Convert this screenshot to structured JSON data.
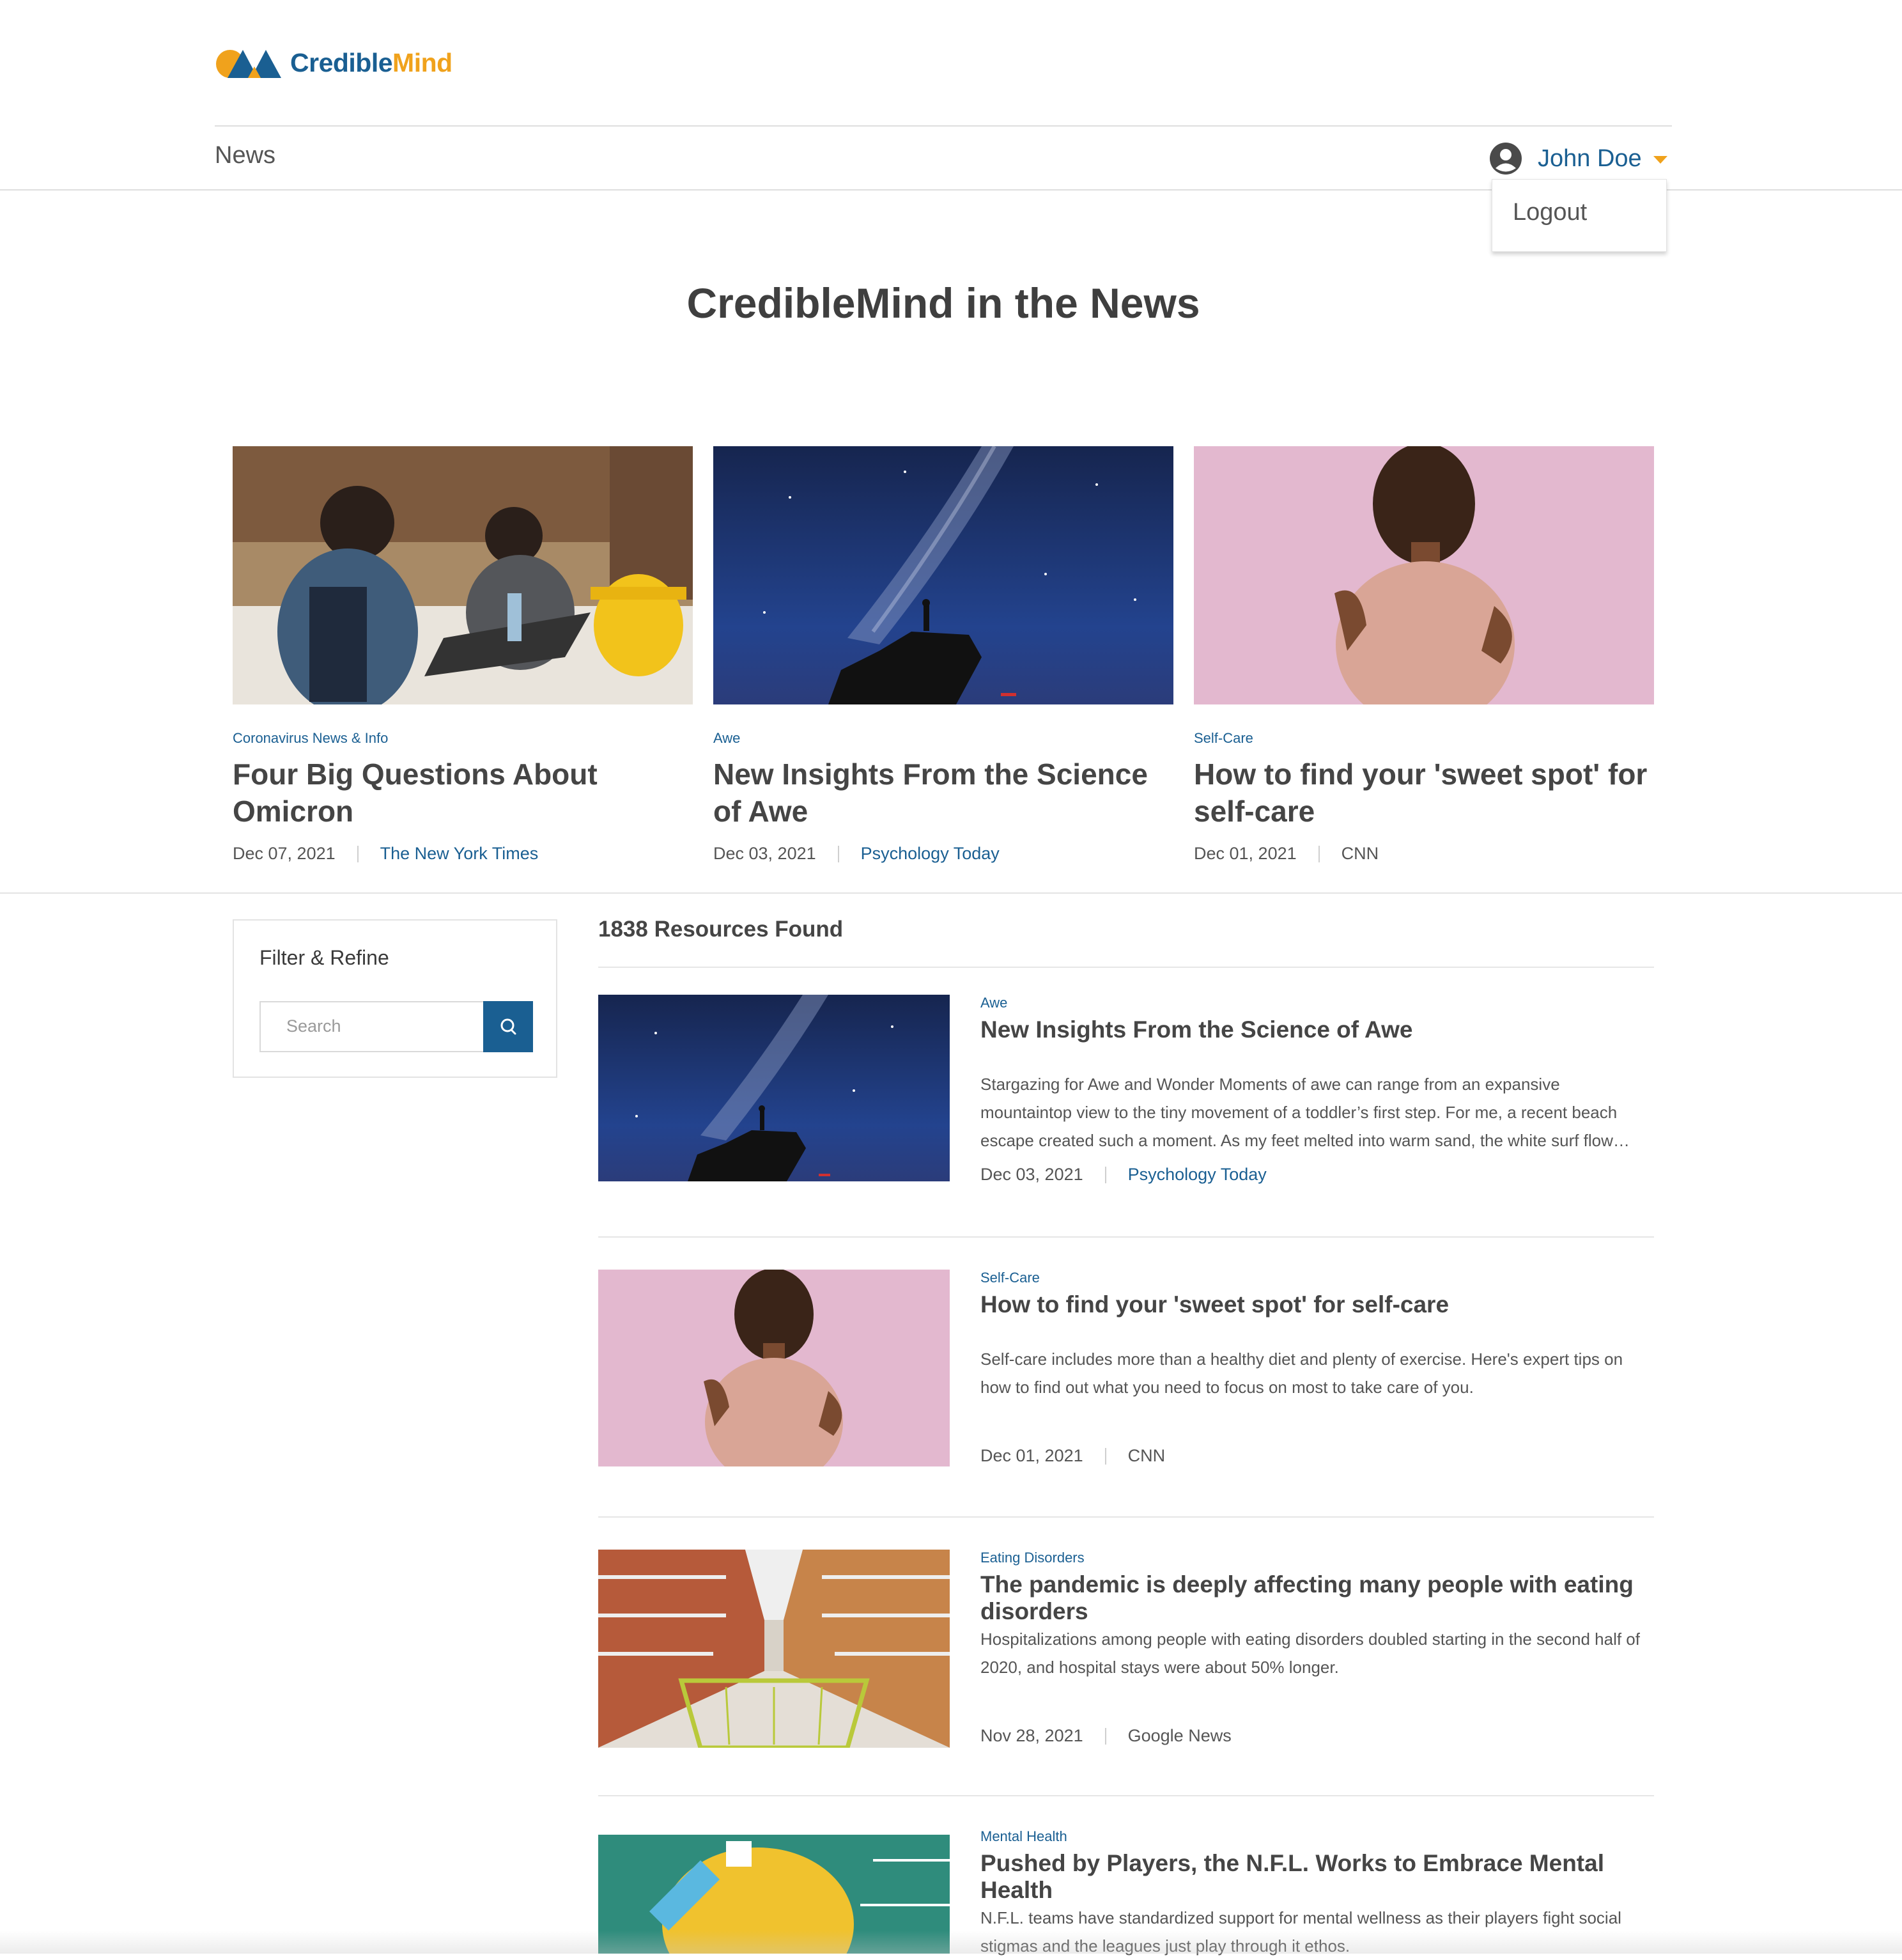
{
  "brand": {
    "name_part1": "Credible",
    "name_part2": "Mind",
    "primary_color": "#1a5f92",
    "accent_color": "#f0a21c"
  },
  "nav": {
    "section_label": "News"
  },
  "user": {
    "name": "John Doe",
    "icon": "user-avatar-icon",
    "menu": {
      "logout_label": "Logout"
    }
  },
  "page": {
    "title": "CredibleMind in the News"
  },
  "featured": [
    {
      "category": "Coronavirus News & Info",
      "title": "Four Big Questions About Omicron",
      "date": "Dec 07, 2021",
      "source": "The New York Times"
    },
    {
      "category": "Awe",
      "title": "New Insights From the Science of Awe",
      "date": "Dec 03, 2021",
      "source": "Psychology Today"
    },
    {
      "category": "Self-Care",
      "title": "How to find your 'sweet spot' for self-care",
      "date": "Dec 01, 2021",
      "source": "CNN"
    }
  ],
  "filter": {
    "title": "Filter & Refine",
    "search_placeholder": "Search",
    "search_icon": "search-icon"
  },
  "results": {
    "count_label": "1838 Resources Found",
    "items": [
      {
        "category": "Awe",
        "title": "New Insights From the Science of Awe",
        "description": "Stargazing for Awe and Wonder Moments of awe can range from an expansive mountaintop view to the tiny movement of a toddler’s first step. For me, a recent beach escape created such a moment. As my feet melted into warm sand, the white surf flow…",
        "date": "Dec 03, 2021",
        "source": "Psychology Today"
      },
      {
        "category": "Self-Care",
        "title": "How to find your 'sweet spot' for self-care",
        "description": "Self-care includes more than a healthy diet and plenty of exercise. Here's expert tips on how to find out what you need to focus on most to take care of you.",
        "date": "Dec 01, 2021",
        "source": "CNN"
      },
      {
        "category": "Eating Disorders",
        "title": "The pandemic is deeply affecting many people with eating disorders",
        "description": "Hospitalizations among people with eating disorders doubled starting in the second half of 2020, and hospital stays were about 50% longer.",
        "date": "Nov 28, 2021",
        "source": "Google News"
      },
      {
        "category": "Mental Health",
        "title": "Pushed by Players, the N.F.L. Works to Embrace Mental Health",
        "description": "N.F.L. teams have standardized support for mental wellness as their players fight social stigmas and the leagues just play through it ethos."
      }
    ]
  }
}
